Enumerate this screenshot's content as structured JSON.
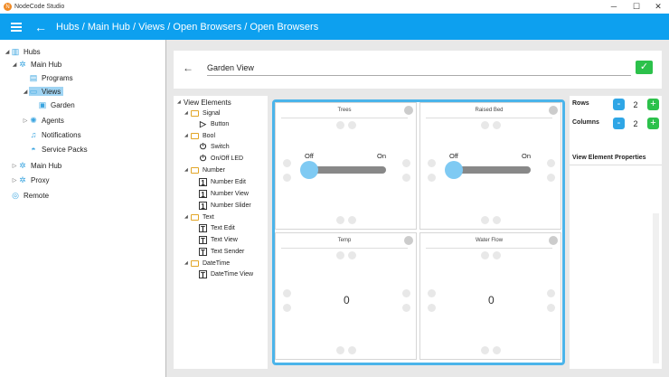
{
  "window": {
    "title": "NodeCode Studio",
    "minimize": "─",
    "maximize": "☐",
    "close": "✕"
  },
  "header": {
    "breadcrumb": "Hubs / Main Hub / Views / Open Browsers / Open Browsers"
  },
  "tree": {
    "hubs": "Hubs",
    "main_hub": "Main Hub",
    "views": "Views",
    "garden": "Garden",
    "programs": "Programs",
    "agents": "Agents",
    "notifications": "Notifications",
    "service_packs": "Service Packs",
    "main_hub_2": "Main Hub",
    "proxy": "Proxy",
    "remote": "Remote"
  },
  "view_name": "Garden View",
  "elements": {
    "root": "View Elements",
    "signal": "Signal",
    "button": "Button",
    "bool": "Bool",
    "switch": "Switch",
    "onoff_led": "On/Off LED",
    "number": "Number",
    "number_edit": "Number Edit",
    "number_view": "Number View",
    "number_slider": "Number Slider",
    "text": "Text",
    "text_edit": "Text Edit",
    "text_view": "Text View",
    "text_sender": "Text Sender",
    "datetime": "DateTime",
    "datetime_view": "DateTime View"
  },
  "cells": [
    {
      "title": "Trees",
      "off": "Off",
      "on": "On"
    },
    {
      "title": "Raised Bed",
      "off": "Off",
      "on": "On"
    },
    {
      "title": "Temp",
      "value": "0"
    },
    {
      "title": "Water Flow",
      "value": "0"
    }
  ],
  "props": {
    "rows_label": "Rows",
    "rows_value": "2",
    "columns_label": "Columns",
    "columns_value": "2",
    "title": "View Element Properties",
    "minus": "-",
    "plus": "+"
  },
  "colors": {
    "accent": "#0da0ef",
    "ok": "#2cc14b",
    "selection": "#9fd4f3"
  }
}
